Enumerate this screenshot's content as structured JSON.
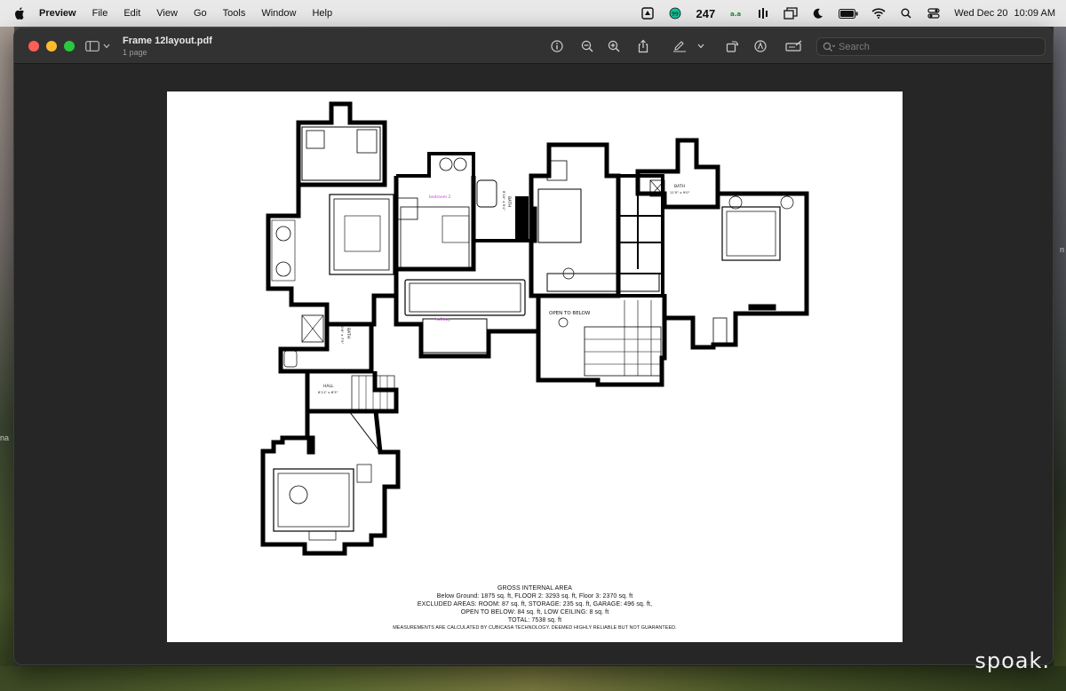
{
  "menubar": {
    "app": "Preview",
    "items": [
      "File",
      "Edit",
      "View",
      "Go",
      "Tools",
      "Window",
      "Help"
    ],
    "status": {
      "counter": "247",
      "date": "Wed Dec 20",
      "time": "10:09 AM"
    }
  },
  "window": {
    "title": "Frame 12layout.pdf",
    "subtitle": "1 page",
    "search_placeholder": "Search"
  },
  "plan": {
    "room_labels": {
      "bedroom": "bedroom 2",
      "bath_upper": "BATH",
      "bath_upper_dim": "11'0\" x 9'0\"",
      "bath_middle": "BATH",
      "bath_middle_dim": "8'10\" x 5'4\"",
      "bath_lower": "BATH",
      "bath_lower_dim": "10'6\" x 7'5\"",
      "hall": "HALL",
      "hall_dim": "6'11\" x 6'3\"",
      "hallway": "hallway",
      "open_to_below": "OPEN TO BELOW"
    },
    "summary": {
      "heading": "GROSS INTERNAL AREA",
      "line1": "Below Ground: 1875 sq. ft, FLOOR 2: 3293 sq. ft, Floor 3: 2370 sq. ft",
      "line2": "EXCLUDED AREAS: ROOM: 87 sq. ft, STORAGE: 235 sq. ft, GARAGE: 496 sq. ft,",
      "line3": "OPEN TO BELOW: 84 sq. ft, LOW CEILING: 8 sq. ft",
      "line4": "TOTAL: 7538 sq. ft",
      "disclaimer": "MEASUREMENTS ARE CALCULATED BY CUBICASA TECHNOLOGY. DEEMED HIGHLY RELIABLE BUT NOT GUARANTEED."
    }
  },
  "watermark": "spoak.",
  "desktop_fragments": {
    "left1": "na",
    "right1": "n"
  },
  "colors": {
    "accent_label": "#c040d0",
    "window_bg": "#262626",
    "titlebar": "#323232"
  }
}
